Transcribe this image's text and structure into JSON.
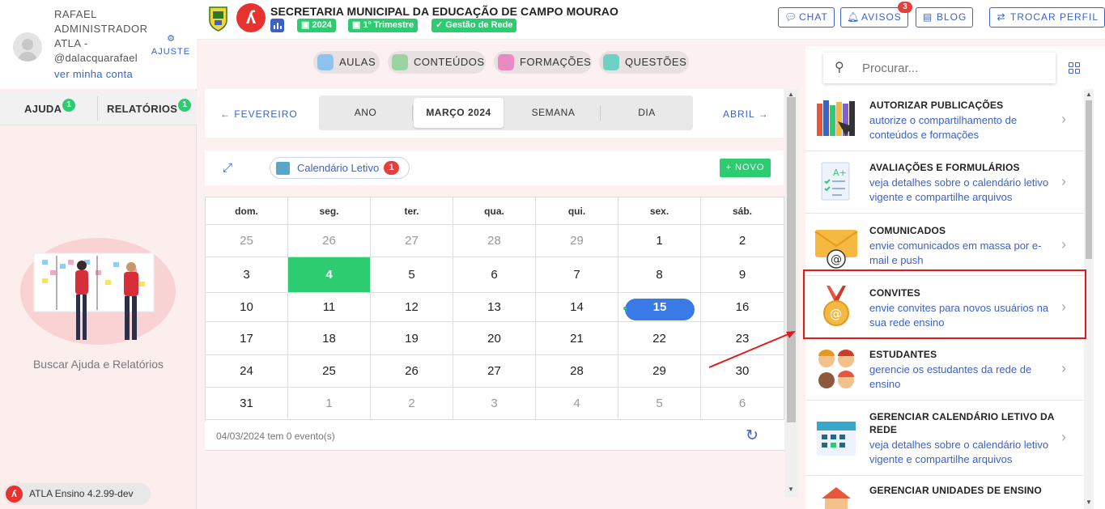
{
  "user": {
    "name": "RAFAEL ADMINISTRADOR ATLA -",
    "handle": "@dalacquarafael",
    "account_link": "ver minha conta",
    "settings_label": "AJUSTE"
  },
  "sidebar": {
    "help_label": "AJUDA",
    "help_count": "1",
    "reports_label": "RELATÓRIOS",
    "reports_count": "1",
    "help_text": "Buscar Ajuda e Relatórios",
    "version": "ATLA Ensino 4.2.99-dev"
  },
  "header": {
    "org_name": "SECRETARIA MUNICIPAL DA EDUCAÇÃO DE CAMPO MOURAO",
    "year": "2024",
    "term": "1º Trimestre",
    "network": "Gestão de Rede",
    "chat": "CHAT",
    "notices": "AVISOS",
    "notices_count": "3",
    "blog": "BLOG",
    "switch_profile": "TROCAR PERFIL"
  },
  "nav": {
    "lessons": "AULAS",
    "contents": "CONTEÚDOS",
    "trainings": "FORMAÇÕES",
    "questions": "QUESTÕES"
  },
  "calendar": {
    "prev": "FEVEREIRO",
    "next": "ABRIL",
    "views": [
      "ANO",
      "MARÇO 2024",
      "SEMANA",
      "DIA"
    ],
    "active_view": "MARÇO 2024",
    "chip": "Calendário Letivo",
    "chip_count": "1",
    "new_button": "NOVO",
    "weekdays": [
      "dom.",
      "seg.",
      "ter.",
      "qua.",
      "qui.",
      "sex.",
      "sáb."
    ],
    "weeks": [
      [
        "25",
        "26",
        "27",
        "28",
        "29",
        "1",
        "2"
      ],
      [
        "3",
        "4",
        "5",
        "6",
        "7",
        "8",
        "9"
      ],
      [
        "10",
        "11",
        "12",
        "13",
        "14",
        "15",
        "16"
      ],
      [
        "17",
        "18",
        "19",
        "20",
        "21",
        "22",
        "23"
      ],
      [
        "24",
        "25",
        "26",
        "27",
        "28",
        "29",
        "30"
      ],
      [
        "31",
        "1",
        "2",
        "3",
        "4",
        "5",
        "6"
      ]
    ],
    "today": "4",
    "selected": "15",
    "footer": "04/03/2024 tem 0 evento(s)"
  },
  "panel": {
    "search_placeholder": "Procurar...",
    "items": [
      {
        "title": "AUTORIZAR PUBLICAÇÕES",
        "desc": "autorize o compartilhamento de conteúdos e formações"
      },
      {
        "title": "AVALIAÇÕES E FORMULÁRIOS",
        "desc": "veja detalhes sobre o calendário letivo vigente e compartilhe arquivos"
      },
      {
        "title": "COMUNICADOS",
        "desc": "envie comunicados em massa por e-mail e push"
      },
      {
        "title": "CONVITES",
        "desc": "envie convites para novos usuários na sua rede ensino"
      },
      {
        "title": "ESTUDANTES",
        "desc": "gerencie os estudantes da rede de ensino"
      },
      {
        "title": "GERENCIAR CALENDÁRIO LETIVO DA REDE",
        "desc": "veja detalhes sobre o calendário letivo vigente e compartilhe arquivos"
      },
      {
        "title": "GERENCIAR UNIDADES DE ENSINO",
        "desc": ""
      }
    ]
  },
  "colors": {
    "accent": "#3a62c9",
    "success": "#2ecc71",
    "danger": "#e53e3e",
    "highlight": "#e01b1b"
  }
}
